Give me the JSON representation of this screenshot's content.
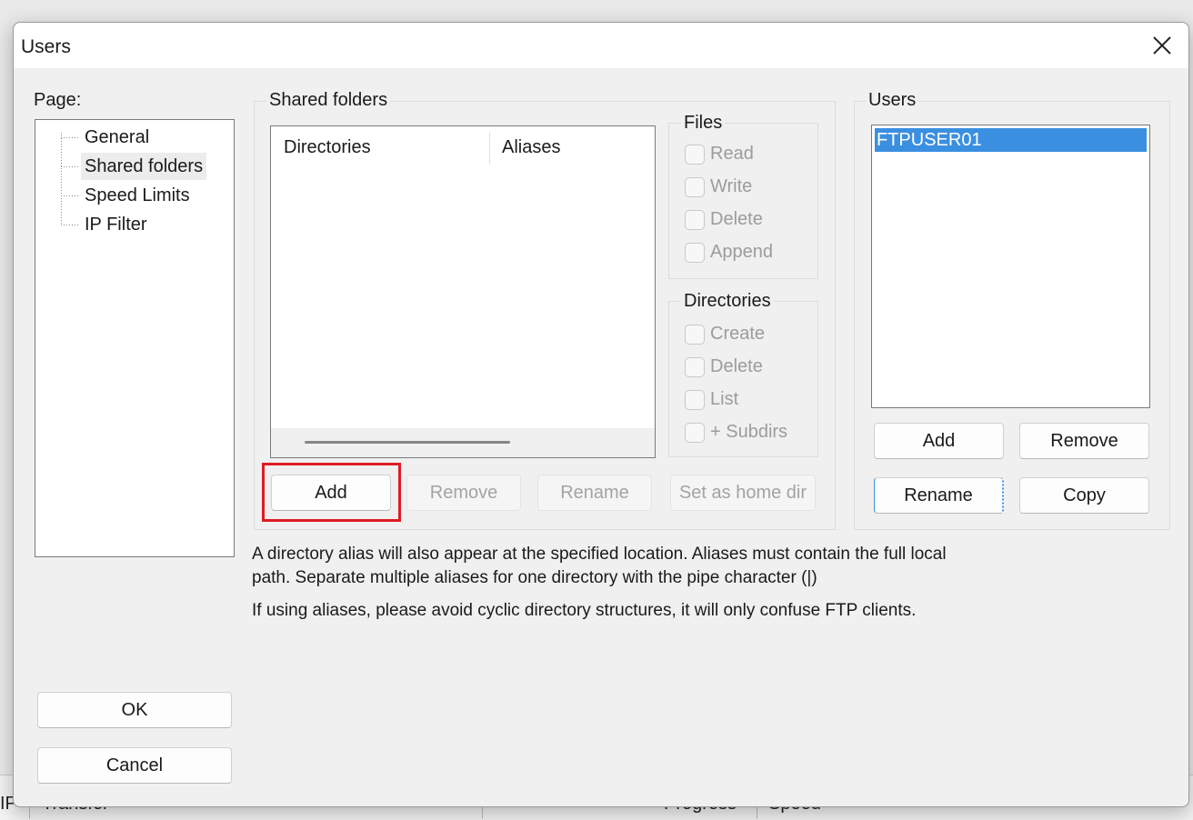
{
  "background": {
    "col1": "IP",
    "col2": "Transfer",
    "col3": "Progress",
    "col4": "Speed"
  },
  "dialog": {
    "title": "Users",
    "close_icon": "close-icon"
  },
  "page_panel": {
    "label": "Page:",
    "items": [
      {
        "label": "General",
        "selected": false
      },
      {
        "label": "Shared folders",
        "selected": true
      },
      {
        "label": "Speed Limits",
        "selected": false
      },
      {
        "label": "IP Filter",
        "selected": false
      }
    ]
  },
  "shared_folders": {
    "group_title": "Shared folders",
    "columns": [
      "Directories",
      "Aliases"
    ],
    "rows": [],
    "files_group": {
      "title": "Files",
      "options": [
        "Read",
        "Write",
        "Delete",
        "Append"
      ]
    },
    "directories_group": {
      "title": "Directories",
      "options": [
        "Create",
        "Delete",
        "List",
        "+ Subdirs"
      ]
    },
    "buttons": {
      "add": "Add",
      "remove": "Remove",
      "rename": "Rename",
      "set_home": "Set as home dir"
    }
  },
  "users_panel": {
    "group_title": "Users",
    "users": [
      "FTPUSER01"
    ],
    "buttons": {
      "add": "Add",
      "remove": "Remove",
      "rename": "Rename",
      "copy": "Copy"
    }
  },
  "info": {
    "line1": "A directory alias will also appear at the specified location. Aliases must contain the full local",
    "line2": "path. Separate multiple aliases for one directory with the pipe character (|)",
    "line3": "If using aliases, please avoid cyclic directory structures, it will only confuse FTP clients."
  },
  "footer_buttons": {
    "ok": "OK",
    "cancel": "Cancel"
  },
  "colors": {
    "highlight": "#e01b24",
    "selection": "#3b8fe0"
  }
}
